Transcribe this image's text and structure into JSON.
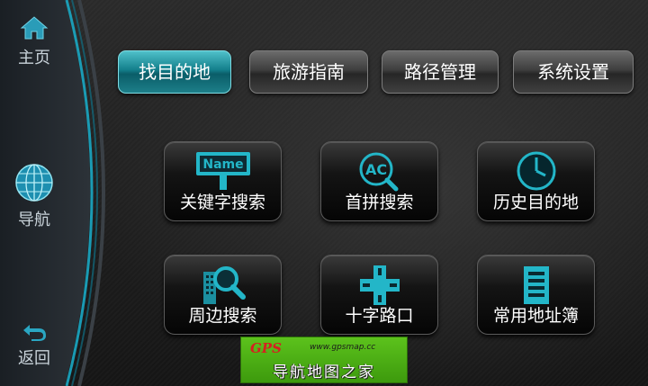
{
  "sidebar": {
    "home_label": "主页",
    "nav_label": "导航",
    "back_label": "返回",
    "accent_color": "#19a9c4"
  },
  "tabs": [
    {
      "label": "找目的地",
      "active": true
    },
    {
      "label": "旅游指南",
      "active": false
    },
    {
      "label": "路径管理",
      "active": false
    },
    {
      "label": "系统设置",
      "active": false
    }
  ],
  "tiles": [
    {
      "label": "关键字搜索",
      "icon": "name-search-icon",
      "icon_text": "Name"
    },
    {
      "label": "首拼搜索",
      "icon": "initials-search-icon",
      "icon_text": "AC"
    },
    {
      "label": "历史目的地",
      "icon": "clock-icon"
    },
    {
      "label": "周边搜索",
      "icon": "nearby-search-icon"
    },
    {
      "label": "十字路口",
      "icon": "crossroad-icon"
    },
    {
      "label": "常用地址簿",
      "icon": "address-book-icon"
    }
  ],
  "watermark": {
    "logo": "GPS",
    "url": "www.gpsmap.cc",
    "text": "导航地图之家"
  },
  "colors": {
    "icon": "#23b6c8",
    "active_tab": "#137f8b",
    "watermark_bg": "#4fb015"
  }
}
